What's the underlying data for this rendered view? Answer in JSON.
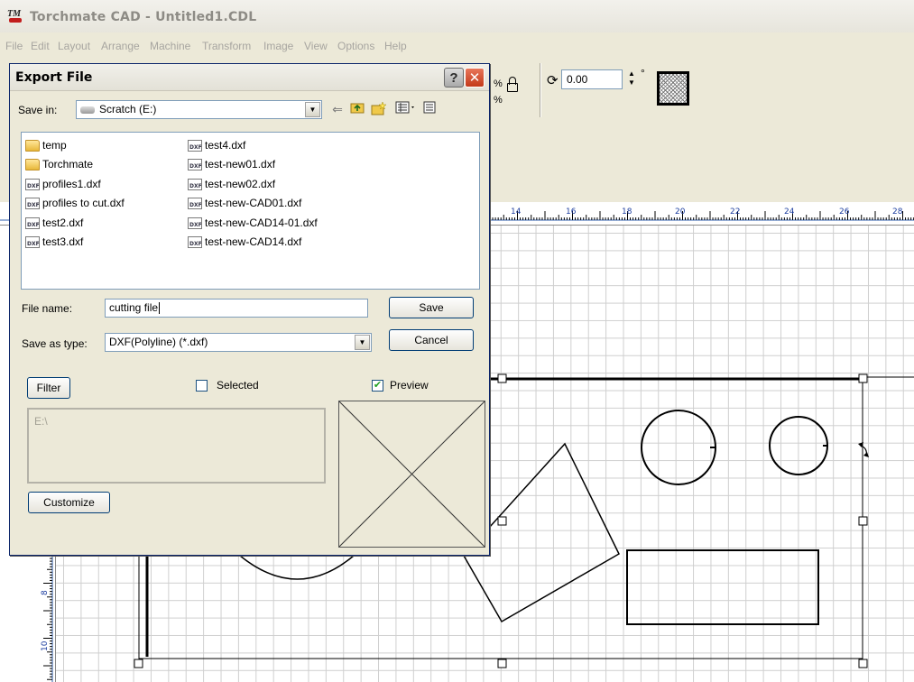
{
  "app": {
    "title": "Torchmate CAD - Untitled1.CDL",
    "icon_label": "TM"
  },
  "menu": [
    "File",
    "Edit",
    "Layout",
    "Arrange",
    "Machine",
    "Transform",
    "Image",
    "View",
    "Options",
    "Help"
  ],
  "toolbar": {
    "rotation_value": "0.00",
    "degree_symbol": "°",
    "scale_pct_top": "%",
    "scale_pct_bottom": "%",
    "spin_up": "▲",
    "spin_down": "▼"
  },
  "ruler": {
    "top_labels": [
      "14",
      "16",
      "18",
      "20",
      "22",
      "24",
      "26",
      "28"
    ],
    "left_labels": [
      "8",
      "10"
    ]
  },
  "dialog": {
    "title": "Export File",
    "help_glyph": "?",
    "close_glyph": "✕",
    "save_in_label": "Save in:",
    "save_in_value": "Scratch (E:)",
    "dropdown_glyph": "▼",
    "files_col1": [
      {
        "name": "temp",
        "type": "folder"
      },
      {
        "name": "Torchmate",
        "type": "folder"
      },
      {
        "name": "profiles1.dxf",
        "type": "dxf"
      },
      {
        "name": "profiles to cut.dxf",
        "type": "dxf"
      },
      {
        "name": "test2.dxf",
        "type": "dxf"
      },
      {
        "name": "test3.dxf",
        "type": "dxf"
      }
    ],
    "files_col2": [
      {
        "name": "test4.dxf",
        "type": "dxf"
      },
      {
        "name": "test-new01.dxf",
        "type": "dxf"
      },
      {
        "name": "test-new02.dxf",
        "type": "dxf"
      },
      {
        "name": "test-new-CAD01.dxf",
        "type": "dxf"
      },
      {
        "name": "test-new-CAD14-01.dxf",
        "type": "dxf"
      },
      {
        "name": "test-new-CAD14.dxf",
        "type": "dxf"
      }
    ],
    "file_name_label": "File name:",
    "file_name_value": "cutting file",
    "save_type_label": "Save as type:",
    "save_type_value": "DXF(Polyline) (*.dxf)",
    "save_button": "Save",
    "cancel_button": "Cancel",
    "filter_button": "Filter",
    "selected_label": "Selected",
    "selected_checked": false,
    "preview_label": "Preview",
    "preview_checked": true,
    "check_glyph": "✔",
    "path_value": "E:\\",
    "customize_button": "Customize"
  }
}
